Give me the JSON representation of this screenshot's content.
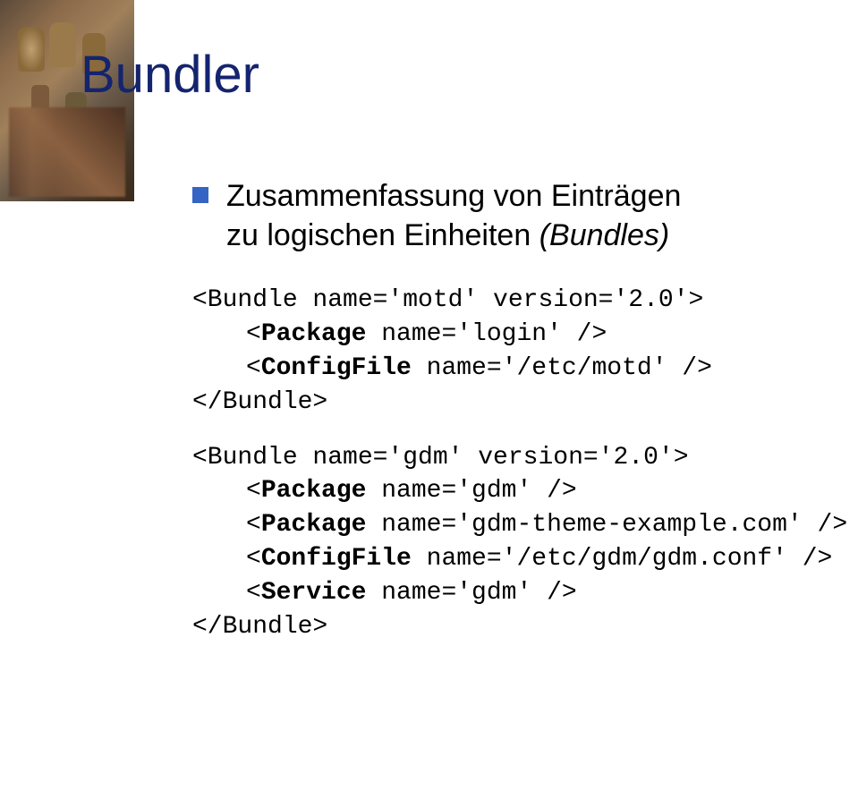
{
  "title": "Bundler",
  "summary": {
    "line1": "Zusammenfassung von Einträgen",
    "line2_pre": "zu logischen Einheiten ",
    "line2_italic": "(Bundles)"
  },
  "code1": {
    "l1": "<Bundle name='motd' version='2.0'>",
    "l2_pre": "<",
    "l2_bold": "Package",
    "l2_post": " name='login' />",
    "l3_pre": "<",
    "l3_bold": "ConfigFile",
    "l3_post": " name='/etc/motd' />",
    "l4": "</Bundle>"
  },
  "code2": {
    "l1": "<Bundle name='gdm' version='2.0'>",
    "l2_pre": "<",
    "l2_bold": "Package",
    "l2_post": " name='gdm' />",
    "l3_pre": "<",
    "l3_bold": "Package",
    "l3_post": " name='gdm-theme-example.com' />",
    "l4_pre": "<",
    "l4_bold": "ConfigFile",
    "l4_post": " name='/etc/gdm/gdm.conf' />",
    "l5_pre": "<",
    "l5_bold": "Service",
    "l5_post": " name='gdm' />",
    "l6": "</Bundle>"
  }
}
